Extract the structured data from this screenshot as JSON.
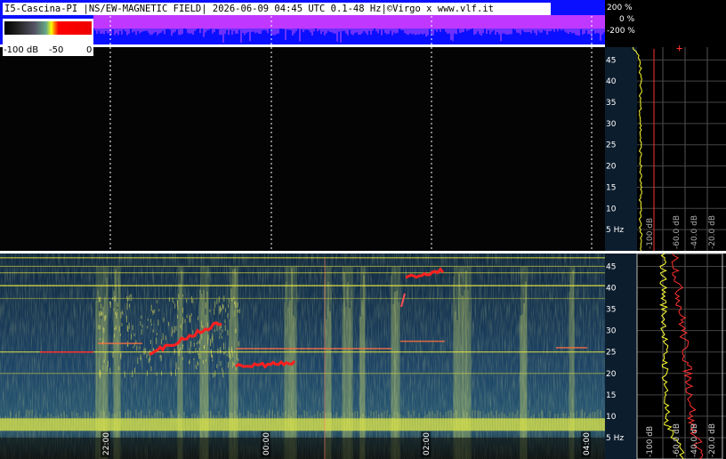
{
  "header": {
    "title": "I5-Cascina-PI |NS/EW-MAGNETIC FIELD| 2026-06-09 04:45 UTC 0.1-48 Hz|©Virgo x www.vlf.it"
  },
  "color_scale": {
    "min_label": "-100 dB",
    "mid_label": "-50",
    "max_label": "0"
  },
  "amplitude_scale": {
    "labels": [
      "200 %",
      "0 %",
      "-200 %"
    ]
  },
  "frequency_axis": {
    "unit_label": "5 Hz",
    "ticks": [
      "45",
      "40",
      "35",
      "30",
      "25",
      "20",
      "15",
      "10"
    ]
  },
  "spectrum_axis": {
    "labels": [
      "-100 dB",
      "-60.0 dB",
      "-40.0 dB",
      "-20.0 dB"
    ]
  },
  "time_axis": {
    "labels": [
      "22:00",
      "00:00",
      "02:00",
      "04:00"
    ]
  },
  "colors": {
    "title_bg": "#ffffff",
    "amplitude_band": "#0a10ff",
    "amplitude_trace": "#ff33cc",
    "spectrogram_bg": "#1b3a55",
    "band_line": "#f0f040",
    "red_trace": "#ff2020",
    "spectrum_panel_bg": "#0c1d2e",
    "spectrum_yellow": "#ffff33",
    "spectrum_red": "#ff3030"
  }
}
